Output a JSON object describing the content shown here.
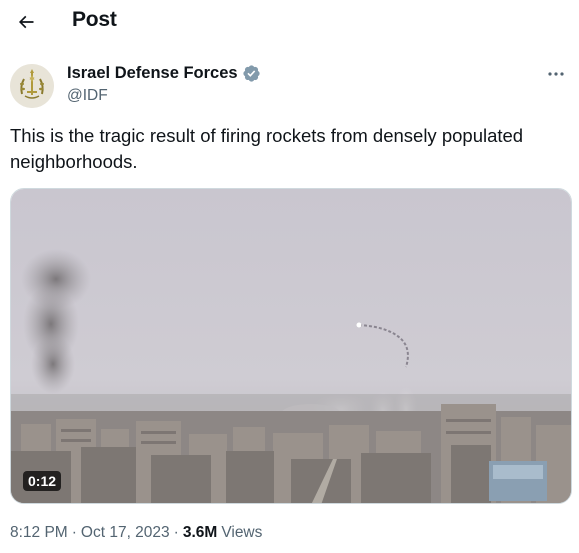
{
  "header": {
    "title": "Post",
    "back_icon": "arrow-left-icon"
  },
  "author": {
    "name": "Israel Defense Forces",
    "handle": "@IDF",
    "verified": true,
    "verified_color": "#829aab",
    "avatar_icon": "idf-emblem-icon"
  },
  "tweet": {
    "text": "This is the tragic result of firing rockets from densely populated neighborhoods."
  },
  "media": {
    "type": "video",
    "duration": "0:12"
  },
  "meta": {
    "time": "8:12 PM",
    "separator": "·",
    "date": "Oct 17, 2023",
    "views_count": "3.6M",
    "views_label": "Views"
  },
  "colors": {
    "text_primary": "#0f1419",
    "text_secondary": "#536471",
    "border": "#cfd9de"
  }
}
